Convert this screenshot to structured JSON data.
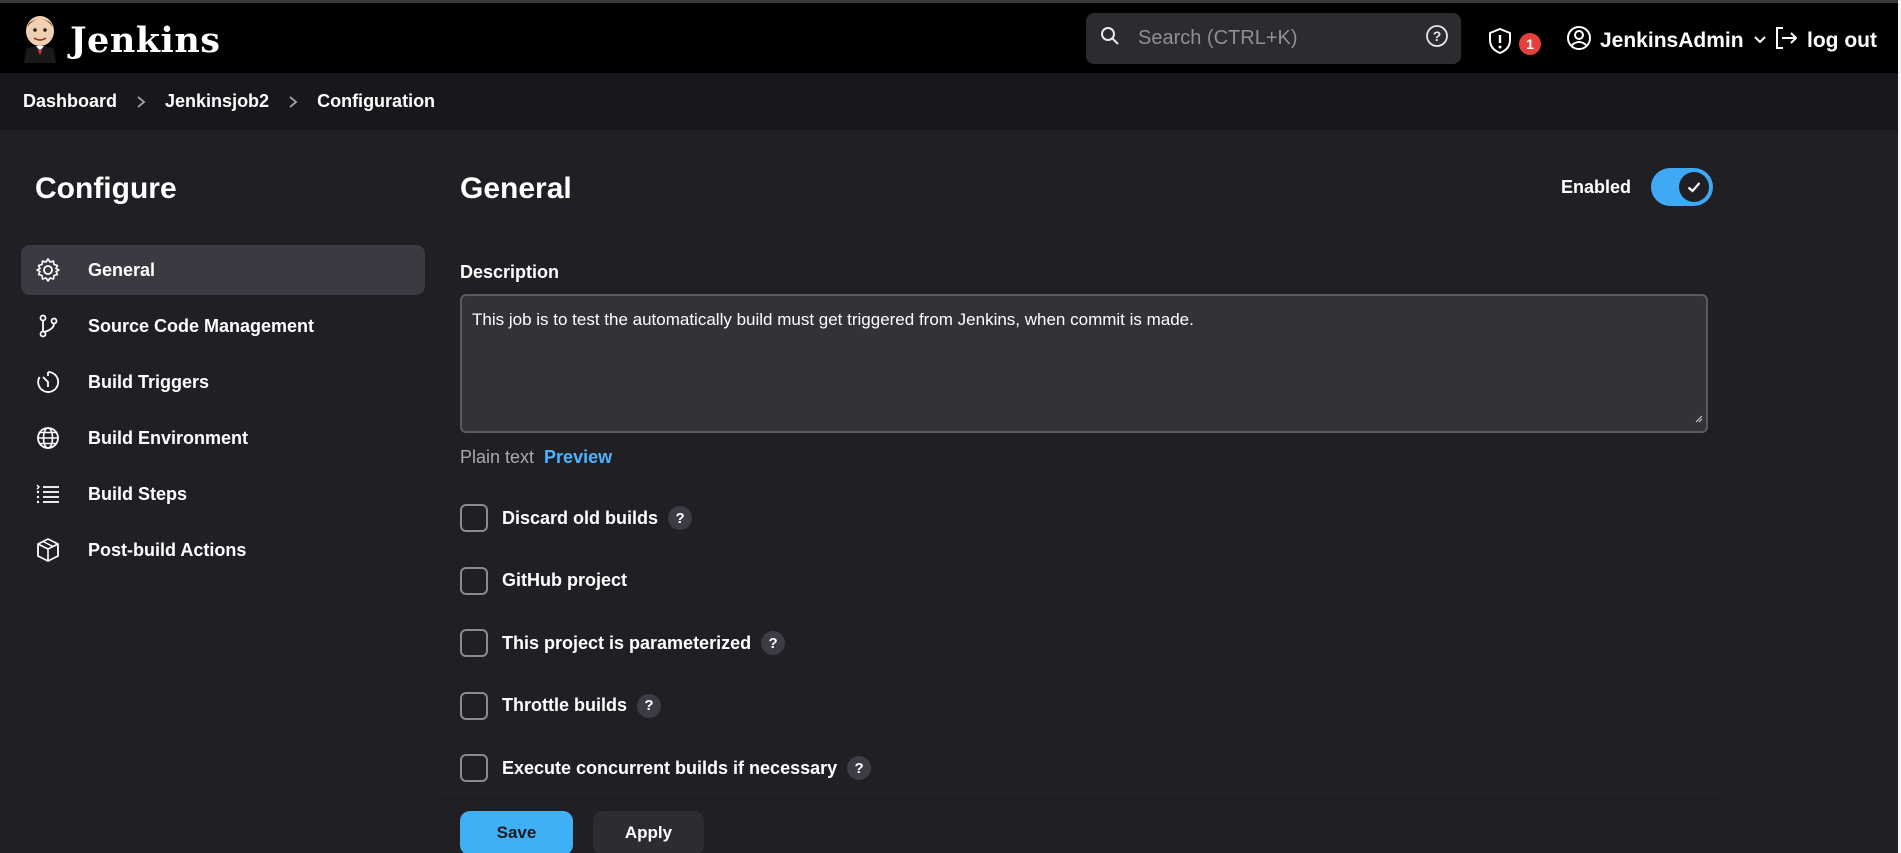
{
  "header": {
    "brand": "Jenkins",
    "search_placeholder": "Search (CTRL+K)",
    "security_count": "1",
    "user": "JenkinsAdmin",
    "logout": "log out"
  },
  "breadcrumb": [
    "Dashboard",
    "Jenkinsjob2",
    "Configuration"
  ],
  "sidebar": {
    "title": "Configure",
    "items": [
      {
        "label": "General",
        "icon": "gear-icon",
        "active": true
      },
      {
        "label": "Source Code Management",
        "icon": "git-branch-icon"
      },
      {
        "label": "Build Triggers",
        "icon": "timer-icon"
      },
      {
        "label": "Build Environment",
        "icon": "globe-icon"
      },
      {
        "label": "Build Steps",
        "icon": "list-icon"
      },
      {
        "label": "Post-build Actions",
        "icon": "cube-icon"
      }
    ]
  },
  "main": {
    "title": "General",
    "enabled_label": "Enabled",
    "enabled": true,
    "description_label": "Description",
    "description_value": "This job is to test the automatically build must get triggered from Jenkins, when commit is made.",
    "format_plain": "Plain text",
    "format_preview": "Preview",
    "options": [
      {
        "label": "Discard old builds",
        "help": "?"
      },
      {
        "label": "GitHub project"
      },
      {
        "label": "This project is parameterized",
        "help": "?"
      },
      {
        "label": "Throttle builds",
        "help": "?"
      },
      {
        "label": "Execute concurrent builds if necessary",
        "help": "?"
      }
    ],
    "save_label": "Save",
    "apply_label": "Apply"
  },
  "colors": {
    "accent": "#3fa9f5",
    "badge": "#e6403a",
    "background": "#1f1f24"
  }
}
